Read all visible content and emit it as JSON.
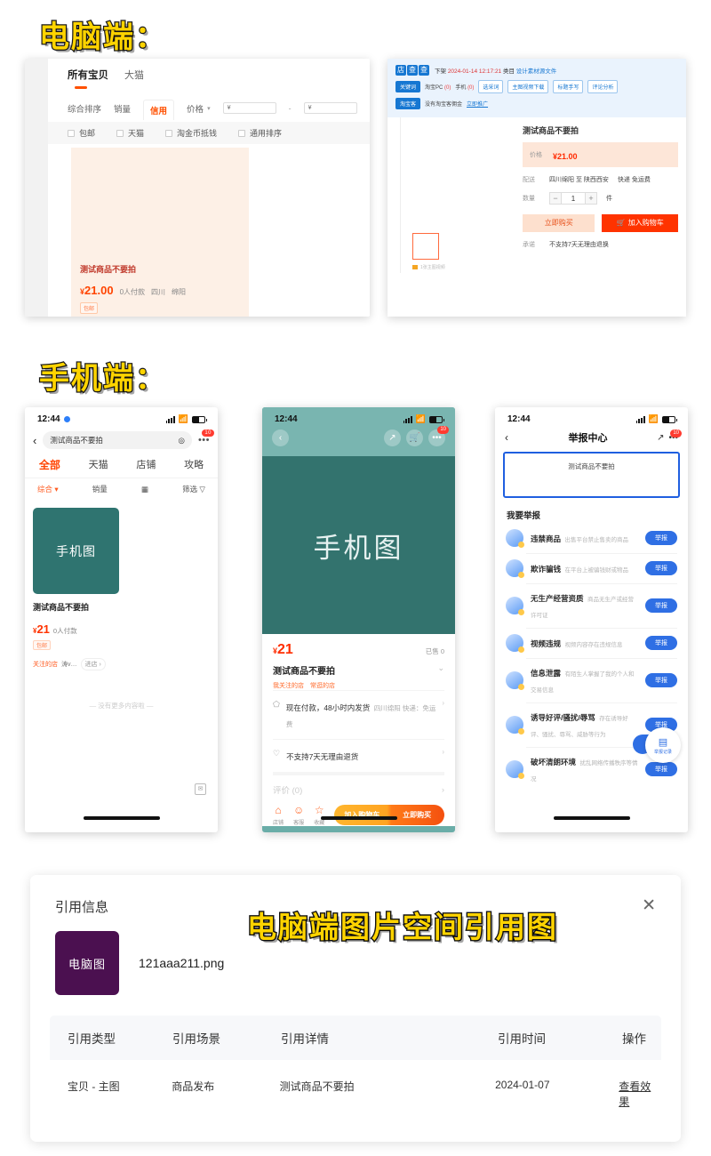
{
  "headings": {
    "desktop": "电脑端：",
    "mobile": "手机端：",
    "overlay": "电脑端图片空间引用图"
  },
  "desktop_search": {
    "tabs": [
      {
        "label": "所有宝贝",
        "active": true
      },
      {
        "label": "大猫",
        "active": false
      }
    ],
    "sorts": [
      {
        "label": "综合排序",
        "selected": false
      },
      {
        "label": "销量",
        "selected": false
      },
      {
        "label": "信用",
        "selected": true
      }
    ],
    "price_label": "价格",
    "price_min_placeholder": "¥",
    "price_max_placeholder": "¥",
    "range_dash": "-",
    "filters": [
      "包邮",
      "天猫",
      "淘金币抵钱",
      "通用排序"
    ],
    "product": {
      "title": "测试商品不要拍",
      "currency": "¥",
      "price": "21.00",
      "sales": "0人付款",
      "province": "四川",
      "city": "绵阳",
      "tag": "包邮"
    }
  },
  "desktop_detail": {
    "brand": "店查查",
    "brand_logo_chars": [
      "店",
      "查",
      "查"
    ],
    "meta_prefix": "下架",
    "meta_time": "2024-01-14 12:17:21",
    "meta_mid": "类目",
    "meta_link": "设计素材源文件",
    "row1": {
      "pill": "关键词",
      "pc_label": "淘宝PC",
      "pc_count": "(0)",
      "mobile_label": "手机",
      "mobile_count": "(0)",
      "buttons": [
        "选采词",
        "主图视频下载",
        "标题手写",
        "评论分析"
      ]
    },
    "row2": {
      "pill": "淘宝客",
      "text": "没有淘宝客佣金",
      "link": "立即推广"
    },
    "product": {
      "title": "测试商品不要拍",
      "price_label": "价格",
      "currency": "¥",
      "price": "21.00",
      "ship_label": "配送",
      "ship_value": "四川绵阳 至 陕西西安",
      "ship_extra": "快递 免运费",
      "qty_label": "数量",
      "qty_minus": "−",
      "qty_value": "1",
      "qty_plus": "+",
      "qty_unit": "件",
      "buy_now": "立即购买",
      "add_cart": "加入购物车",
      "promise_label": "承诺",
      "promise_value": "不支持7天无理由退换"
    },
    "thumb_caption": "1张主图视频"
  },
  "phone_search": {
    "status": {
      "time": "12:44"
    },
    "search_value": "测试商品不要拍",
    "tabs": [
      {
        "label": "全部",
        "active": true
      },
      {
        "label": "天猫",
        "active": false
      },
      {
        "label": "店铺",
        "active": false
      },
      {
        "label": "攻略",
        "active": false
      }
    ],
    "sorts": [
      {
        "label": "综合 ▾",
        "active": true
      },
      {
        "label": "销量",
        "active": false
      },
      {
        "label": "筛选 ▽",
        "active": false
      }
    ],
    "image_caption": "手机图",
    "product": {
      "title": "测试商品不要拍",
      "currency": "¥",
      "price": "21",
      "sales": "0人付款",
      "tag": "包邮",
      "shop_follow": "关注的店",
      "shop_name": "涛v…",
      "shop_enter": "进店 ›"
    },
    "end_text": "— 没有更多内容啦 —"
  },
  "phone_detail": {
    "status": {
      "time": "12:44"
    },
    "image_caption": "手机图",
    "currency": "¥",
    "price": "21",
    "sold": "已售 0",
    "title": "测试商品不要拍",
    "tags": [
      "我关注的店",
      "常逛的店"
    ],
    "rows": [
      {
        "main": "现在付款，48小时内发货",
        "sub": "四川绵阳 快递：免运费"
      },
      {
        "main": "不支持7天无理由退货",
        "sub": ""
      }
    ],
    "reviews_label": "评价 (0)",
    "icon_buttons": [
      {
        "label": "店铺"
      },
      {
        "label": "客服"
      },
      {
        "label": "收藏"
      }
    ],
    "add_cart": "加入购物车",
    "buy_now": "立即购买"
  },
  "phone_report": {
    "status": {
      "time": "12:44"
    },
    "nav_title": "举报中心",
    "card_text": "测试商品不要拍",
    "section_title": "我要举报",
    "items": [
      {
        "title": "违禁商品",
        "has_help": true,
        "desc": "出售平台禁止售卖的商品",
        "action": "举报"
      },
      {
        "title": "欺诈骗钱",
        "has_help": false,
        "desc": "在平台上被骗钱财或物品",
        "action": "举报"
      },
      {
        "title": "无生产经营资质",
        "has_help": true,
        "desc": "商品无生产或经营许可证",
        "action": "举报"
      },
      {
        "title": "视频违规",
        "has_help": false,
        "desc": "视频内容存在违规信息",
        "action": "举报"
      },
      {
        "title": "信息泄露",
        "has_help": false,
        "desc": "有陌生人掌握了我的个人和交易信息",
        "action": "举报"
      },
      {
        "title": "诱导好评/骚扰/辱骂",
        "has_help": false,
        "desc": "存在诱导好评、骚扰、辱骂、威胁等行为",
        "action": "举报"
      },
      {
        "title": "破坏清朗环境",
        "has_help": true,
        "desc": "扰乱网络传播秩序等情况",
        "action": "举报"
      }
    ],
    "float_label": "举报记录"
  },
  "dialog": {
    "title": "引用信息",
    "close": "✕",
    "thumb_text": "电脑图",
    "filename": "121aaa211.png",
    "table": {
      "headers": [
        "引用类型",
        "引用场景",
        "引用详情",
        "引用时间",
        "操作"
      ],
      "rows": [
        {
          "type": "宝贝 - 主图",
          "scene": "商品发布",
          "detail": "测试商品不要拍",
          "time": "2024-01-07",
          "action": "查看效果"
        }
      ]
    }
  },
  "colors": {
    "accent_orange": "#ff4400",
    "brand_blue": "#1677d2",
    "report_blue": "#2f6fe4",
    "heading_yellow": "#FFD400",
    "hero_green": "#33736e",
    "thumb_purple": "#4b1050"
  }
}
